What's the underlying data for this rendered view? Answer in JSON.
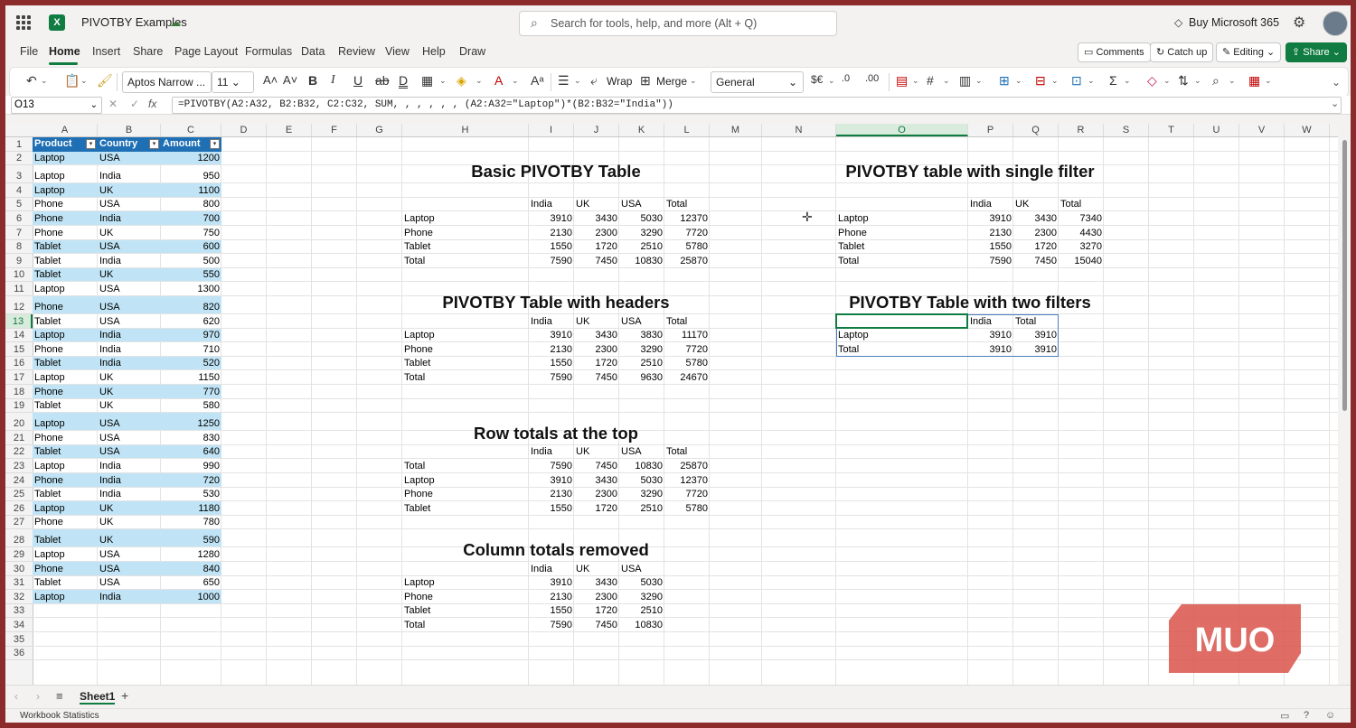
{
  "titlebar": {
    "workbook_name": "PIVOTBY Examples",
    "search_placeholder": "Search for tools, help, and more (Alt + Q)",
    "buy_label": "Buy Microsoft 365"
  },
  "tabs": [
    "File",
    "Home",
    "Insert",
    "Share",
    "Page Layout",
    "Formulas",
    "Data",
    "Review",
    "View",
    "Help",
    "Draw"
  ],
  "active_tab": "Home",
  "actions": {
    "comments": "Comments",
    "catch_up": "Catch up",
    "editing": "Editing",
    "share": "Share"
  },
  "ribbon": {
    "font_name": "Aptos Narrow ...",
    "font_size": "11",
    "wrap_label": "Wrap",
    "merge_label": "Merge",
    "number_format": "General"
  },
  "formula_bar": {
    "name_box": "O13",
    "formula": "=PIVOTBY(A2:A32, B2:B32, C2:C32, SUM, , , , , , (A2:A32=\"Laptop\")*(B2:B32=\"India\"))"
  },
  "columns": [
    "A",
    "B",
    "C",
    "D",
    "E",
    "F",
    "G",
    "H",
    "I",
    "J",
    "K",
    "L",
    "M",
    "N",
    "O",
    "P",
    "Q",
    "R",
    "S",
    "T",
    "U",
    "V",
    "W"
  ],
  "selected_column": "O",
  "selected_row": "13",
  "source_table": {
    "headers": [
      "Product",
      "Country",
      "Amount"
    ],
    "rows": [
      [
        "Laptop",
        "USA",
        "1200"
      ],
      [
        "Laptop",
        "India",
        "950"
      ],
      [
        "Laptop",
        "UK",
        "1100"
      ],
      [
        "Phone",
        "USA",
        "800"
      ],
      [
        "Phone",
        "India",
        "700"
      ],
      [
        "Phone",
        "UK",
        "750"
      ],
      [
        "Tablet",
        "USA",
        "600"
      ],
      [
        "Tablet",
        "India",
        "500"
      ],
      [
        "Tablet",
        "UK",
        "550"
      ],
      [
        "Laptop",
        "USA",
        "1300"
      ],
      [
        "Phone",
        "USA",
        "820"
      ],
      [
        "Tablet",
        "USA",
        "620"
      ],
      [
        "Laptop",
        "India",
        "970"
      ],
      [
        "Phone",
        "India",
        "710"
      ],
      [
        "Tablet",
        "India",
        "520"
      ],
      [
        "Laptop",
        "UK",
        "1150"
      ],
      [
        "Phone",
        "UK",
        "770"
      ],
      [
        "Tablet",
        "UK",
        "580"
      ],
      [
        "Laptop",
        "USA",
        "1250"
      ],
      [
        "Phone",
        "USA",
        "830"
      ],
      [
        "Tablet",
        "USA",
        "640"
      ],
      [
        "Laptop",
        "India",
        "990"
      ],
      [
        "Phone",
        "India",
        "720"
      ],
      [
        "Tablet",
        "India",
        "530"
      ],
      [
        "Laptop",
        "UK",
        "1180"
      ],
      [
        "Phone",
        "UK",
        "780"
      ],
      [
        "Tablet",
        "UK",
        "590"
      ],
      [
        "Laptop",
        "USA",
        "1280"
      ],
      [
        "Phone",
        "USA",
        "840"
      ],
      [
        "Tablet",
        "USA",
        "650"
      ],
      [
        "Laptop",
        "India",
        "1000"
      ]
    ]
  },
  "pivot_basic": {
    "title": "Basic PIVOTBY Table",
    "header": [
      "India",
      "UK",
      "USA",
      "Total"
    ],
    "rows": [
      [
        "Laptop",
        "3910",
        "3430",
        "5030",
        "12370"
      ],
      [
        "Phone",
        "2130",
        "2300",
        "3290",
        "7720"
      ],
      [
        "Tablet",
        "1550",
        "1720",
        "2510",
        "5780"
      ],
      [
        "Total",
        "7590",
        "7450",
        "10830",
        "25870"
      ]
    ]
  },
  "pivot_headers": {
    "title": "PIVOTBY Table with headers",
    "header": [
      "India",
      "UK",
      "USA",
      "Total"
    ],
    "rows": [
      [
        "Laptop",
        "3910",
        "3430",
        "3830",
        "11170"
      ],
      [
        "Phone",
        "2130",
        "2300",
        "3290",
        "7720"
      ],
      [
        "Tablet",
        "1550",
        "1720",
        "2510",
        "5780"
      ],
      [
        "Total",
        "7590",
        "7450",
        "9630",
        "24670"
      ]
    ]
  },
  "pivot_rowtotals": {
    "title": "Row totals at the top",
    "header": [
      "India",
      "UK",
      "USA",
      "Total"
    ],
    "rows": [
      [
        "Total",
        "7590",
        "7450",
        "10830",
        "25870"
      ],
      [
        "Laptop",
        "3910",
        "3430",
        "5030",
        "12370"
      ],
      [
        "Phone",
        "2130",
        "2300",
        "3290",
        "7720"
      ],
      [
        "Tablet",
        "1550",
        "1720",
        "2510",
        "5780"
      ]
    ]
  },
  "pivot_coltotals": {
    "title": "Column totals removed",
    "header": [
      "India",
      "UK",
      "USA"
    ],
    "rows": [
      [
        "Laptop",
        "3910",
        "3430",
        "5030"
      ],
      [
        "Phone",
        "2130",
        "2300",
        "3290"
      ],
      [
        "Tablet",
        "1550",
        "1720",
        "2510"
      ],
      [
        "Total",
        "7590",
        "7450",
        "10830"
      ]
    ]
  },
  "pivot_single": {
    "title": "PIVOTBY table with single filter",
    "header": [
      "India",
      "UK",
      "Total"
    ],
    "rows": [
      [
        "Laptop",
        "3910",
        "3430",
        "7340"
      ],
      [
        "Phone",
        "2130",
        "2300",
        "4430"
      ],
      [
        "Tablet",
        "1550",
        "1720",
        "3270"
      ],
      [
        "Total",
        "7590",
        "7450",
        "15040"
      ]
    ]
  },
  "pivot_two": {
    "title": "PIVOTBY Table with two filters",
    "header": [
      "India",
      "Total"
    ],
    "rows": [
      [
        "Laptop",
        "3910",
        "3910"
      ],
      [
        "Total",
        "3910",
        "3910"
      ]
    ]
  },
  "sheet_tab": "Sheet1",
  "status": "Workbook Statistics",
  "watermark": "MUO"
}
